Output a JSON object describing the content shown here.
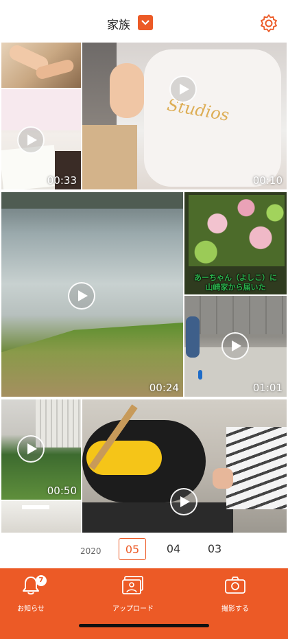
{
  "header": {
    "title": "家族",
    "dropdown_icon": "chevron-down-icon",
    "settings_icon": "gear-icon",
    "accent": "#ec5a26"
  },
  "grid": {
    "tiles": [
      {
        "name": "photo-children-floor",
        "type": "photo"
      },
      {
        "name": "video-child-studying",
        "type": "video",
        "duration": "00:33"
      },
      {
        "name": "video-child-tshirt",
        "type": "video",
        "duration": "00:10"
      },
      {
        "name": "video-rice-field",
        "type": "video",
        "duration": "00:24"
      },
      {
        "name": "photo-flowers",
        "type": "photo",
        "caption": "あーちゃん（よしこ）に\n山崎家から届いた"
      },
      {
        "name": "video-child-scooter",
        "type": "video",
        "duration": "01:01"
      },
      {
        "name": "video-garden",
        "type": "video",
        "duration": "00:50"
      },
      {
        "name": "video-cooking",
        "type": "video"
      },
      {
        "name": "photo-room",
        "type": "photo"
      }
    ]
  },
  "datebar": {
    "year": "2020",
    "months": [
      {
        "label": "05",
        "active": true
      },
      {
        "label": "04",
        "active": false
      },
      {
        "label": "03",
        "active": false
      }
    ]
  },
  "tabbar": {
    "notifications": {
      "label": "お知らせ",
      "badge": "7",
      "icon": "bell-icon"
    },
    "upload": {
      "label": "アップロード",
      "icon": "upload-photos-icon"
    },
    "camera": {
      "label": "撮影する",
      "icon": "camera-icon"
    }
  }
}
